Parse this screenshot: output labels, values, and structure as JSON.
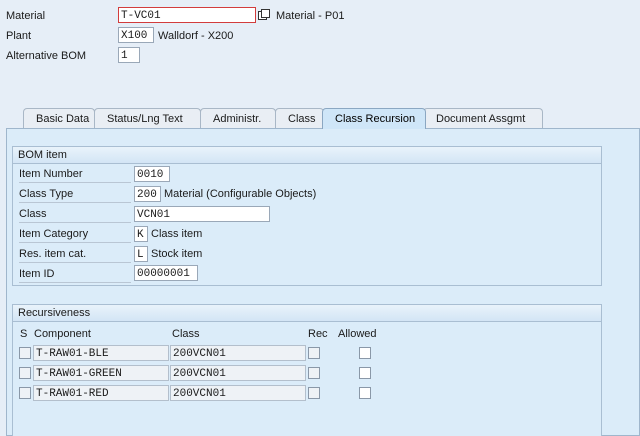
{
  "header": {
    "material_label": "Material",
    "material_value": "T-VC01",
    "material_desc": "Material  - P01",
    "plant_label": "Plant",
    "plant_value": "X100",
    "plant_desc": "Walldorf - X200",
    "altbom_label": "Alternative BOM",
    "altbom_value": "1"
  },
  "tabs": [
    {
      "label": "Basic Data"
    },
    {
      "label": "Status/Lng Text"
    },
    {
      "label": "Administr."
    },
    {
      "label": "Class"
    },
    {
      "label": "Class Recursion"
    },
    {
      "label": "Document Assgmt"
    }
  ],
  "bom_item": {
    "title": "BOM item",
    "item_number_label": "Item Number",
    "item_number_value": "0010",
    "class_type_label": "Class Type",
    "class_type_value": "200",
    "class_type_desc": "Material (Configurable Objects)",
    "class_label": "Class",
    "class_value": "VCN01",
    "item_category_label": "Item Category",
    "item_category_value": "K",
    "item_category_desc": "Class item",
    "res_item_cat_label": "Res. item cat.",
    "res_item_cat_value": "L",
    "res_item_cat_desc": "Stock item",
    "item_id_label": "Item ID",
    "item_id_value": "00000001"
  },
  "recursiveness": {
    "title": "Recursiveness",
    "columns": {
      "s": "S",
      "component": "Component",
      "class": "Class",
      "rec": "Rec",
      "allowed": "Allowed"
    },
    "rows": [
      {
        "component": "T-RAW01-BLE",
        "class": "200VCN01"
      },
      {
        "component": "T-RAW01-GREEN",
        "class": "200VCN01"
      },
      {
        "component": "T-RAW01-RED",
        "class": "200VCN01"
      }
    ]
  }
}
